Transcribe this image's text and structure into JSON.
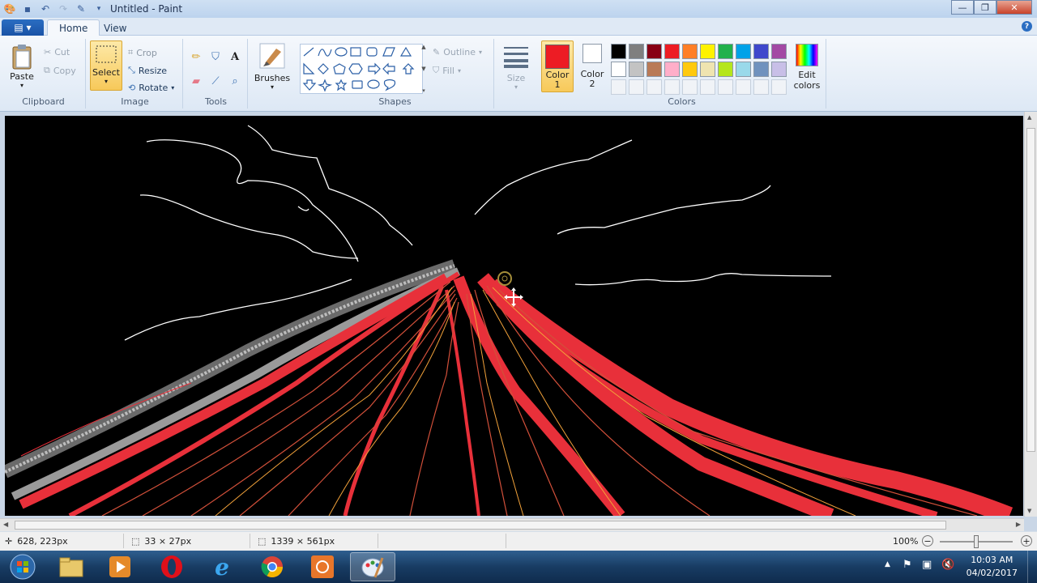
{
  "window": {
    "title": "Untitled - Paint",
    "controls": [
      "—",
      "❐",
      "✕"
    ]
  },
  "tabs": {
    "file_label": "▤ ▾",
    "home": "Home",
    "view": "View",
    "help": "?"
  },
  "ribbon": {
    "clipboard": {
      "label": "Clipboard",
      "paste": "Paste",
      "cut": "Cut",
      "copy": "Copy"
    },
    "image": {
      "label": "Image",
      "select": "Select",
      "crop": "Crop",
      "resize": "Resize",
      "rotate": "Rotate"
    },
    "tools": {
      "label": "Tools"
    },
    "brushes": {
      "label": "Brushes"
    },
    "shapes": {
      "label": "Shapes",
      "outline": "Outline",
      "fill": "Fill"
    },
    "size": {
      "label": "Size"
    },
    "colors": {
      "label": "Colors",
      "color1_label": "Color 1",
      "color1_line1": "Color",
      "color1_line2": "1",
      "color2_line1": "Color",
      "color2_line2": "2",
      "edit_line1": "Edit",
      "edit_line2": "colors",
      "color1_value": "#ed1c24",
      "color2_value": "#ffffff",
      "palette_row1": [
        "#000000",
        "#7f7f7f",
        "#880015",
        "#ed1c24",
        "#ff7f27",
        "#fff200",
        "#22b14c",
        "#00a2e8",
        "#3f48cc",
        "#a349a4"
      ],
      "palette_row2": [
        "#ffffff",
        "#c3c3c3",
        "#b97a57",
        "#ffaec9",
        "#ffc90e",
        "#efe4b0",
        "#b5e61d",
        "#99d9ea",
        "#7092be",
        "#c8bfe7"
      ]
    }
  },
  "status": {
    "cursor_pos": "628, 223px",
    "selection_size": "33 × 27px",
    "image_size": "1339 × 561px",
    "zoom": "100%"
  },
  "taskbar": {
    "time": "10:03 AM",
    "date": "04/02/2017"
  }
}
